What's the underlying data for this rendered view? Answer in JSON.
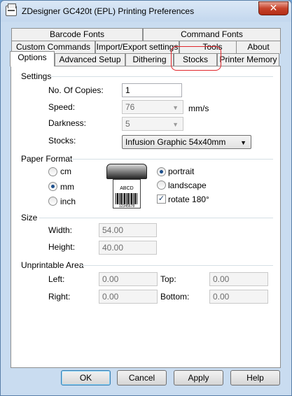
{
  "window": {
    "title": "ZDesigner GC420t (EPL) Printing Preferences",
    "close_glyph": "✕"
  },
  "tabs": {
    "row1": [
      "Barcode Fonts",
      "Command Fonts"
    ],
    "row2": [
      "Custom Commands",
      "Import/Export settings",
      "Tools",
      "About"
    ],
    "row3": [
      "Options",
      "Advanced Setup",
      "Dithering",
      "Stocks",
      "Printer Memory"
    ],
    "active": "Options",
    "highlighted": "Stocks",
    "highlight_color": "#e0262b"
  },
  "settings": {
    "heading": "Settings",
    "copies_label": "No. Of Copies:",
    "copies_value": "1",
    "speed_label": "Speed:",
    "speed_value": "76",
    "speed_unit": "mm/s",
    "darkness_label": "Darkness:",
    "darkness_value": "5",
    "stocks_label": "Stocks:",
    "stocks_value": "Infusion Graphic 54x40mm"
  },
  "paper_format": {
    "heading": "Paper Format",
    "units": [
      "cm",
      "mm",
      "inch"
    ],
    "selected_unit": "mm",
    "orientations": [
      "portrait",
      "landscape"
    ],
    "selected_orientation": "portrait",
    "rotate_label": "rotate 180°",
    "rotate_checked": true,
    "label_text": "ABCD",
    "label_number": "12345678"
  },
  "size": {
    "heading": "Size",
    "width_label": "Width:",
    "width_value": "54.00",
    "height_label": "Height:",
    "height_value": "40.00"
  },
  "unprintable": {
    "heading": "Unprintable Area",
    "left_label": "Left:",
    "left_value": "0.00",
    "top_label": "Top:",
    "top_value": "0.00",
    "right_label": "Right:",
    "right_value": "0.00",
    "bottom_label": "Bottom:",
    "bottom_value": "0.00"
  },
  "buttons": {
    "ok": "OK",
    "cancel": "Cancel",
    "apply": "Apply",
    "help": "Help"
  }
}
